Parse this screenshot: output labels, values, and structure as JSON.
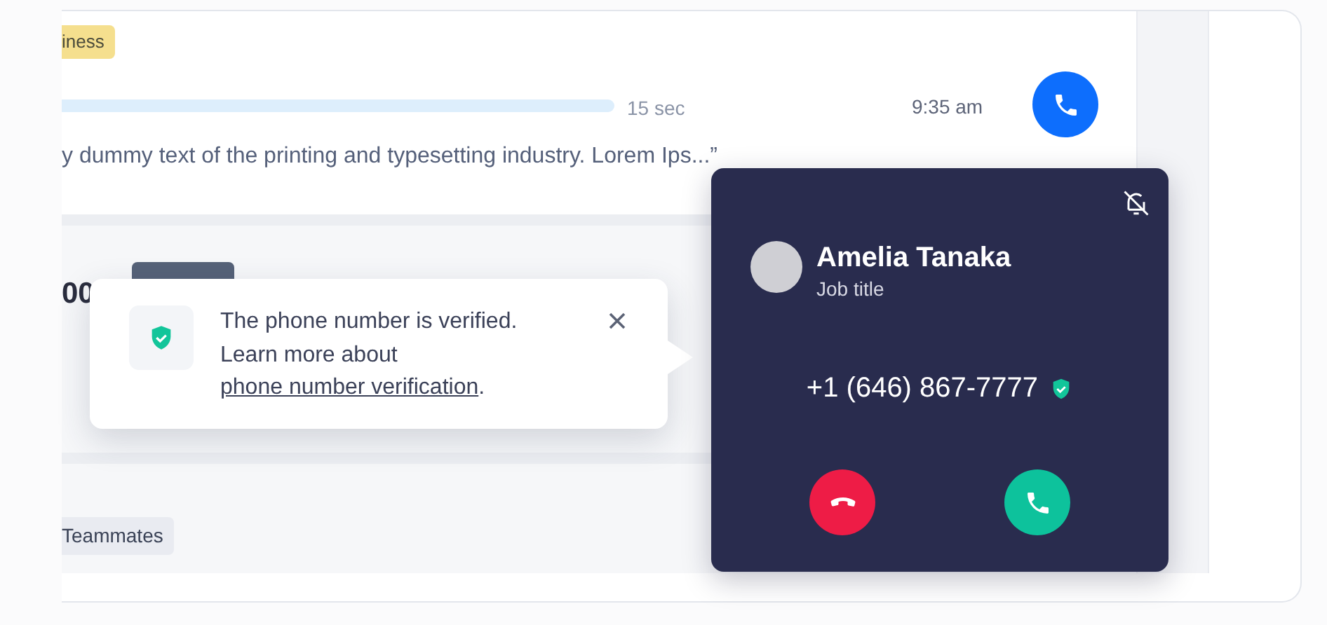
{
  "conversations": [
    {
      "tag": "iness",
      "duration": "15 sec",
      "time": "9:35 am",
      "snippet": "y dummy text of the printing and typesetting industry. Lorem Ips...”"
    },
    {
      "amount": "00"
    },
    {
      "tag": "Teammates"
    }
  ],
  "tooltip": {
    "message": "The phone number is verified.",
    "learn_more": "Learn more about",
    "link": "phone number verification",
    "end": "."
  },
  "incoming_call": {
    "name": "Amelia Tanaka",
    "job_title": "Job title",
    "phone": "+1 (646) 867-7777",
    "verified": true
  }
}
